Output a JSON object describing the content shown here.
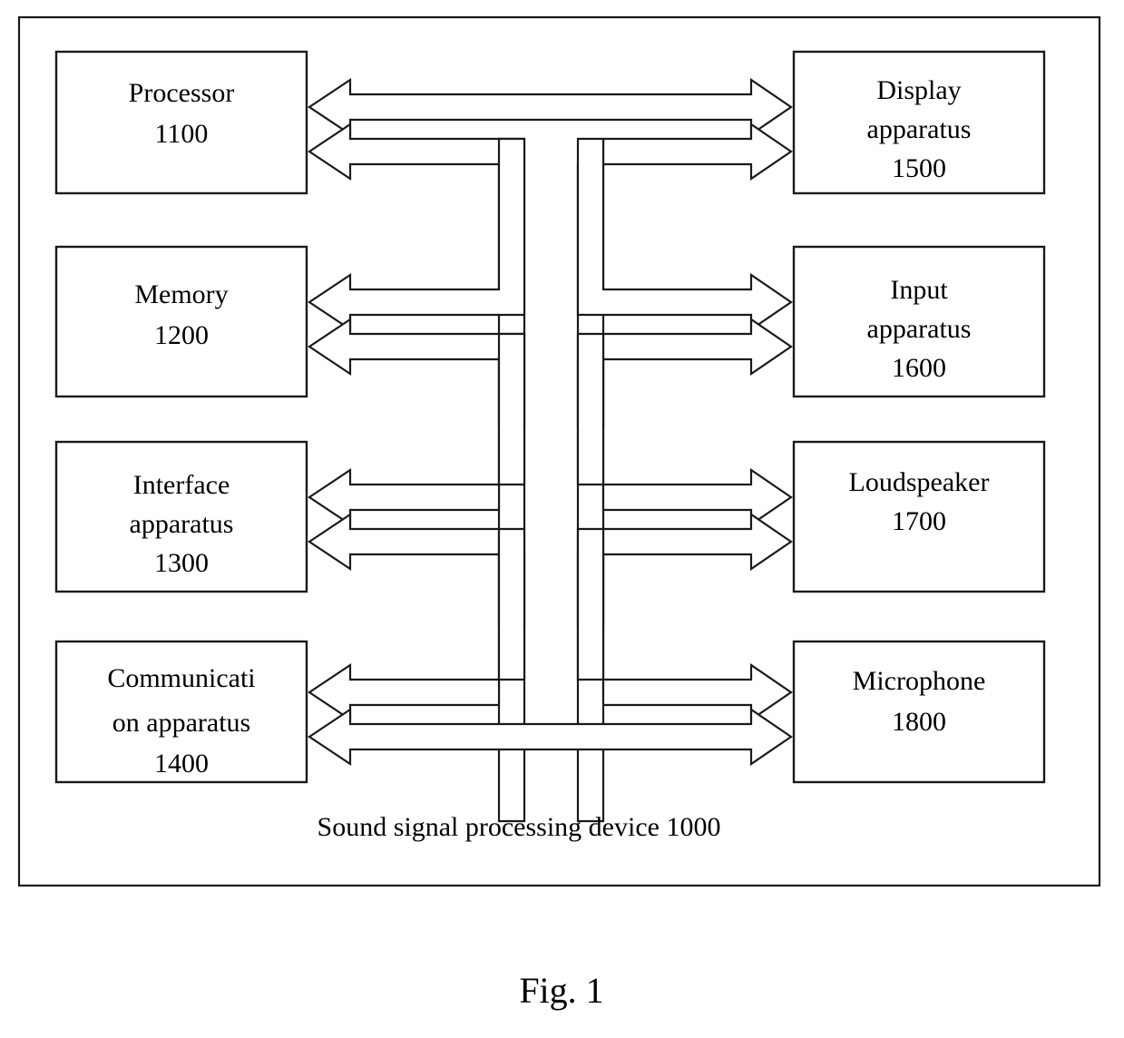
{
  "figure": {
    "label": "Fig. 1",
    "device_caption": "Sound signal processing device 1000",
    "outer_frame_name": "sound-signal-processing-device-1000"
  },
  "colors": {
    "ink": "#1a1a1a",
    "paper": "#ffffff"
  },
  "nodes": {
    "processor": {
      "line1": "Processor",
      "line2": "1100",
      "line3": ""
    },
    "memory": {
      "line1": "Memory",
      "line2": "1200",
      "line3": ""
    },
    "interface_apparatus": {
      "line1": "Interface",
      "line2": "apparatus",
      "line3": "1300"
    },
    "communication_apparatus": {
      "line1": "Communicati",
      "line2": "on apparatus",
      "line3": "1400"
    },
    "display_apparatus": {
      "line1": "Display",
      "line2": "apparatus",
      "line3": "1500"
    },
    "input_apparatus": {
      "line1": "Input",
      "line2": "apparatus",
      "line3": "1600"
    },
    "loudspeaker": {
      "line1": "Loudspeaker",
      "line2": "1700",
      "line3": ""
    },
    "microphone": {
      "line1": "Microphone",
      "line2": "1800",
      "line3": ""
    }
  },
  "connections": [
    {
      "id": "processor-bus",
      "from": "Processor 1100",
      "to": "Bus",
      "direction": "bidirectional"
    },
    {
      "id": "memory-bus",
      "from": "Memory 1200",
      "to": "Bus",
      "direction": "bidirectional"
    },
    {
      "id": "interface-bus",
      "from": "Interface apparatus 1300",
      "to": "Bus",
      "direction": "bidirectional"
    },
    {
      "id": "communication-bus",
      "from": "Communication apparatus 1400",
      "to": "Bus",
      "direction": "bidirectional"
    },
    {
      "id": "bus-display",
      "from": "Bus",
      "to": "Display apparatus 1500",
      "direction": "bidirectional"
    },
    {
      "id": "bus-input",
      "from": "Bus",
      "to": "Input apparatus 1600",
      "direction": "bidirectional"
    },
    {
      "id": "bus-loudspeaker",
      "from": "Bus",
      "to": "Loudspeaker 1700",
      "direction": "bidirectional"
    },
    {
      "id": "bus-microphone",
      "from": "Bus",
      "to": "Microphone 1800",
      "direction": "bidirectional"
    }
  ]
}
